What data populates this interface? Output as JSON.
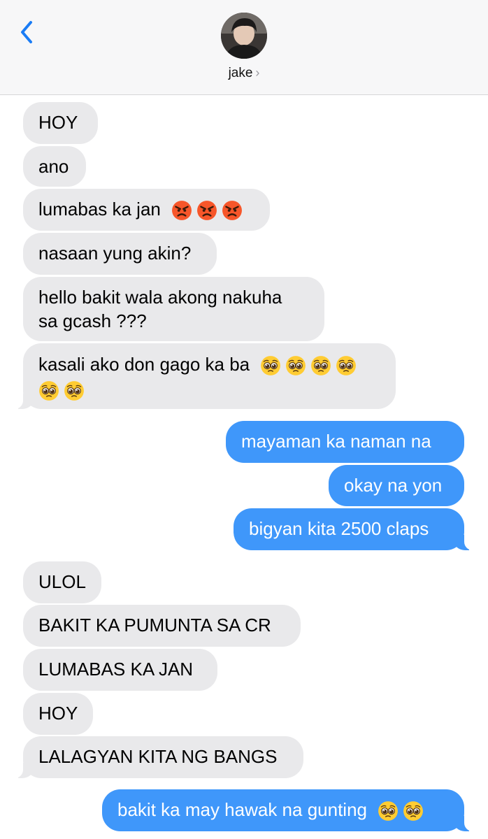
{
  "header": {
    "contact_name": "jake",
    "chevron": "›",
    "back_icon": "chevron-left-icon"
  },
  "colors": {
    "incoming": "#e9e9eb",
    "outgoing": "#3f97fa",
    "accent": "#1a7cf5"
  },
  "messages": [
    {
      "text": "HOY",
      "from": "them"
    },
    {
      "text": "ano",
      "from": "them"
    },
    {
      "text": "lumabas ka jan",
      "from": "them",
      "emoji": [
        "angry-face",
        "angry-face",
        "angry-face"
      ]
    },
    {
      "text": "nasaan yung akin?",
      "from": "them"
    },
    {
      "line1": "hello bakit wala akong nakuha",
      "line2": "sa gcash ???",
      "from": "them"
    },
    {
      "text": "kasali ako don gago ka ba",
      "from": "them",
      "emoji": [
        "pleading-face",
        "pleading-face",
        "pleading-face",
        "pleading-face",
        "pleading-face",
        "pleading-face"
      ]
    },
    {
      "text": "mayaman ka naman na",
      "from": "me"
    },
    {
      "text": "okay na yon",
      "from": "me"
    },
    {
      "text": "bigyan kita 2500 claps",
      "from": "me"
    },
    {
      "text": "ULOL",
      "from": "them"
    },
    {
      "text": "BAKIT KA PUMUNTA SA CR",
      "from": "them"
    },
    {
      "text": "LUMABAS KA JAN",
      "from": "them"
    },
    {
      "text": "HOY",
      "from": "them"
    },
    {
      "text": "LALAGYAN KITA NG BANGS",
      "from": "them"
    },
    {
      "text": "bakit ka may hawak na gunting",
      "from": "me",
      "emoji": [
        "pleading-face",
        "pleading-face"
      ]
    }
  ]
}
